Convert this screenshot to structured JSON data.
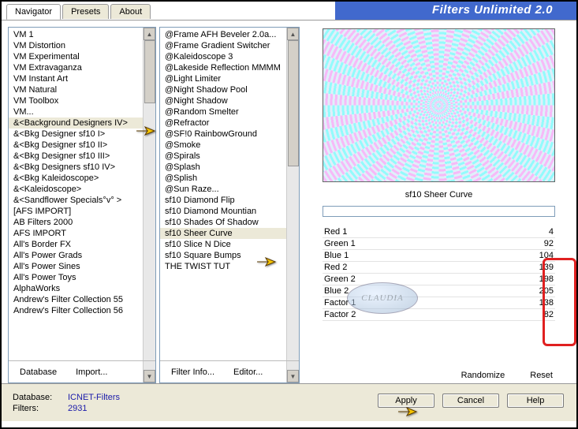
{
  "app_title": "Filters Unlimited 2.0",
  "tabs": [
    "Navigator",
    "Presets",
    "About"
  ],
  "active_tab": 0,
  "col1": {
    "title_hidden": "",
    "items": [
      "VM 1",
      "VM Distortion",
      "VM Experimental",
      "VM Extravaganza",
      "VM Instant Art",
      "VM Natural",
      "VM Toolbox",
      "VM...",
      "&<Background Designers IV>",
      "&<Bkg Designer sf10 I>",
      "&<Bkg Designer sf10 II>",
      "&<Bkg Designer sf10 III>",
      "&<Bkg Designers sf10 IV>",
      "&<Bkg Kaleidoscope>",
      "&<Kaleidoscope>",
      "&<Sandflower Specials°v° >",
      "[AFS IMPORT]",
      "AB Filters 2000",
      "AFS IMPORT",
      "All's Border FX",
      "All's Power Grads",
      "All's Power Sines",
      "All's Power Toys",
      "AlphaWorks",
      "Andrew's Filter Collection 55",
      "Andrew's Filter Collection 56"
    ],
    "selected": 8,
    "toolbar": [
      "Database",
      "Import..."
    ]
  },
  "col2": {
    "items": [
      "@Frame AFH Beveler 2.0a...",
      "@Frame Gradient Switcher",
      "@Kaleidoscope 3",
      "@Lakeside Reflection MMMM",
      "@Light Limiter",
      "@Night Shadow Pool",
      "@Night Shadow",
      "@Random Smelter",
      "@Refractor",
      "@SF!0 RainbowGround",
      "@Smoke",
      "@Spirals",
      "@Splash",
      "@Splish",
      "@Sun Raze...",
      "sf10 Diamond Flip",
      "sf10 Diamond Mountian",
      "sf10 Shades Of Shadow",
      "sf10 Sheer Curve",
      "sf10 Slice N Dice",
      "sf10 Square Bumps",
      "THE TWIST TUT"
    ],
    "selected": 18,
    "toolbar": [
      "Filter Info...",
      "Editor..."
    ]
  },
  "preview_name": "sf10 Sheer Curve",
  "params": [
    {
      "label": "Red 1",
      "value": 4
    },
    {
      "label": "Green 1",
      "value": 92
    },
    {
      "label": "Blue 1",
      "value": 104
    },
    {
      "label": "Red 2",
      "value": 139
    },
    {
      "label": "Green 2",
      "value": 198
    },
    {
      "label": "Blue 2",
      "value": 205
    },
    {
      "label": "Factor 1",
      "value": 138
    },
    {
      "label": "Factor 2",
      "value": 82
    }
  ],
  "right_toolbar": [
    "Randomize",
    "Reset"
  ],
  "footer": {
    "db_label": "Database:",
    "db_value": "ICNET-Filters",
    "flt_label": "Filters:",
    "flt_value": "2931",
    "buttons": [
      "Apply",
      "Cancel",
      "Help"
    ]
  },
  "watermark": "CLAUDIA"
}
